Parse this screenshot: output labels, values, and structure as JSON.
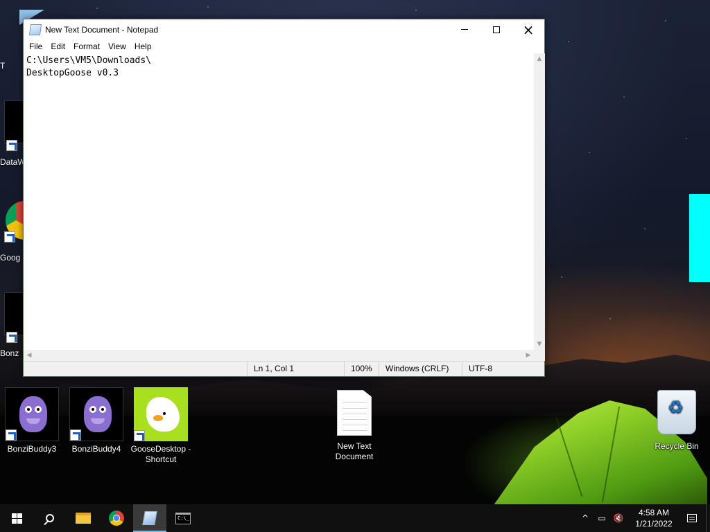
{
  "desktop": {
    "left_partial_labels": [
      "T",
      "DataW",
      "Goog",
      "Bonz"
    ],
    "icons": [
      {
        "label": "BonziBuddy3",
        "icon": "bonzibuddy-icon"
      },
      {
        "label": "BonziBuddy4",
        "icon": "bonzibuddy-icon"
      },
      {
        "label": "GooseDesktop - Shortcut",
        "icon": "goose-icon"
      },
      {
        "label": "New Text Document",
        "icon": "text-document-icon"
      },
      {
        "label": "Recycle Bin",
        "icon": "recycle-bin-icon"
      }
    ],
    "accent_cyan": "#00ffff"
  },
  "window": {
    "title": "New Text Document - Notepad",
    "controls": {
      "minimize": "minimize-icon",
      "maximize": "maximize-icon",
      "close": "×"
    },
    "menu": [
      "File",
      "Edit",
      "Format",
      "View",
      "Help"
    ],
    "content_lines": [
      "C:\\Users\\VM5\\Downloads\\",
      "DesktopGoose v0.3"
    ],
    "status": {
      "position": "Ln 1, Col 1",
      "zoom": "100%",
      "line_ending": "Windows (CRLF)",
      "encoding": "UTF-8"
    }
  },
  "taskbar": {
    "apps": [
      "start-icon",
      "search-icon",
      "file-explorer-icon",
      "chrome-icon",
      "notepad-icon",
      "command-prompt-icon"
    ],
    "active_app": "notepad-icon",
    "tray": {
      "chevron": "^",
      "time": "4:58 AM",
      "date": "1/21/2022"
    }
  }
}
